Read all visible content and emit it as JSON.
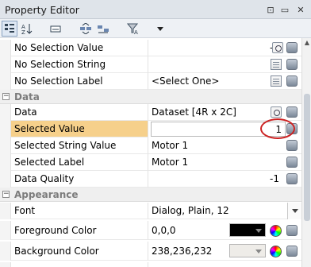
{
  "window": {
    "title": "Property Editor",
    "controls": {
      "pin": "⊞",
      "minimize": "▫",
      "close": "✕"
    }
  },
  "toolbar": {
    "icons": [
      "categorized-view-icon",
      "sort-alpha-icon",
      "keyboard-icon",
      "expand-all-icon",
      "collapse-all-icon",
      "filter-icon",
      "dropdown-icon"
    ]
  },
  "rows": [
    {
      "name": "No Selection Value",
      "value": "-1",
      "editor": "spinner-db"
    },
    {
      "name": "No Selection String",
      "value": "",
      "editor": "doc-db"
    },
    {
      "name": "No Selection Label",
      "value": "<Select One>",
      "editor": "doc-db"
    }
  ],
  "categories": {
    "data": "Data",
    "appearance": "Appearance"
  },
  "data_rows": [
    {
      "name": "Data",
      "value": "Dataset [4R x 2C]"
    },
    {
      "name": "Selected Value",
      "value": "1"
    },
    {
      "name": "Selected String Value",
      "value": "Motor 1"
    },
    {
      "name": "Selected Label",
      "value": "Motor 1"
    },
    {
      "name": "Data Quality",
      "value": "-1"
    }
  ],
  "appearance_rows": [
    {
      "name": "Font",
      "value": "Dialog, Plain, 12"
    },
    {
      "name": "Foreground Color",
      "value": "0,0,0",
      "swatch": "#000000"
    },
    {
      "name": "Background Color",
      "value": "238,236,232",
      "swatch": "#eeece8"
    }
  ]
}
